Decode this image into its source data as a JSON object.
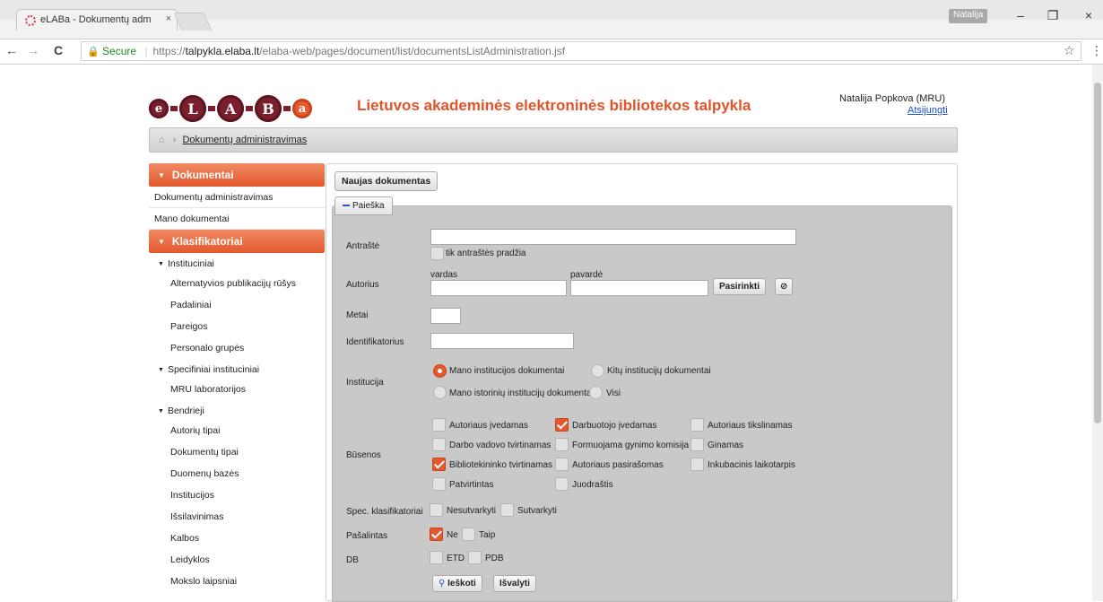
{
  "browser": {
    "tab_title": "eLABa - Dokumentų adm",
    "tab_close": "×",
    "profile": "Natalija",
    "win_min": "–",
    "win_restore": "❐",
    "win_close": "×",
    "nav_back": "←",
    "nav_forward": "→",
    "nav_reload": "C",
    "secure_label": "Secure",
    "url_scheme": "https://",
    "url_host": "talpykla.elaba.lt",
    "url_path": "/elaba-web/pages/document/list/documentsListAdministration.jsf",
    "star": "☆",
    "menu": "⋮"
  },
  "header": {
    "logo_letters": [
      "e",
      "L",
      "A",
      "B",
      "a"
    ],
    "site_title": "Lietuvos akademinės elektroninės bibliotekos talpykla",
    "user_name": "Natalija Popkova (MRU)",
    "logout": "Atsijungti"
  },
  "breadcrumb": {
    "home_icon": "⌂",
    "separator": "›",
    "current": "Dokumentų administravimas"
  },
  "sidebar": {
    "documents_header": "Dokumentai",
    "documents_items": [
      "Dokumentų administravimas",
      "Mano dokumentai"
    ],
    "classifiers_header": "Klasifikatoriai",
    "group_institutional": "Instituciniai",
    "institutional_items": [
      "Alternatyvios publikacijų rūšys",
      "Padaliniai",
      "Pareigos",
      "Personalo grupės"
    ],
    "group_specific": "Specifiniai instituciniai",
    "specific_items": [
      "MRU laboratorijos"
    ],
    "group_common": "Bendrieji",
    "common_items": [
      "Autorių tipai",
      "Dokumentų tipai",
      "Duomenų bazės",
      "Institucijos",
      "Išsilavinimas",
      "Kalbos",
      "Leidyklos",
      "Mokslo laipsniai"
    ]
  },
  "main": {
    "new_document_button": "Naujas dokumentas",
    "search_toggle": "Paieška",
    "title_label": "Antraštė",
    "title_value": "",
    "title_start_only": "tik antraštės pradžia",
    "author_label": "Autorius",
    "first_name_label": "vardas",
    "last_name_label": "pavardė",
    "choose_button": "Pasirinkti",
    "clear_author_icon": "⊘",
    "year_label": "Metai",
    "identifier_label": "Identifikatorius",
    "institution_label": "Institucija",
    "institution_options": [
      "Mano institucijos dokumentai",
      "Kitų institucijų dokumentai",
      "Mano istorinių institucijų dokumentai",
      "Visi"
    ],
    "institution_selected": "Mano institucijos dokumentai",
    "states_label": "Būsenos",
    "states": [
      {
        "label": "Autoriaus įvedamas",
        "checked": false
      },
      {
        "label": "Darbuotojo įvedamas",
        "checked": true
      },
      {
        "label": "Autoriaus tikslinamas",
        "checked": false
      },
      {
        "label": "Darbo vadovo tvirtinamas",
        "checked": false
      },
      {
        "label": "Formuojama gynimo komisija",
        "checked": false
      },
      {
        "label": "Ginamas",
        "checked": false
      },
      {
        "label": "Bibliotekininko tvirtinamas",
        "checked": true
      },
      {
        "label": "Autoriaus pasirašomas",
        "checked": false
      },
      {
        "label": "Inkubacinis laikotarpis",
        "checked": false
      },
      {
        "label": "Patvirtintas",
        "checked": false
      },
      {
        "label": "Juodraštis",
        "checked": false
      }
    ],
    "spec_label": "Spec. klasifikatoriai",
    "spec_options": [
      {
        "label": "Nesutvarkyti",
        "checked": false
      },
      {
        "label": "Sutvarkyti",
        "checked": false
      }
    ],
    "removed_label": "Pašalintas",
    "removed_options": [
      {
        "label": "Ne",
        "checked": true
      },
      {
        "label": "Taip",
        "checked": false
      }
    ],
    "db_label": "DB",
    "db_options": [
      {
        "label": "ETD",
        "checked": false
      },
      {
        "label": "PDB",
        "checked": false
      }
    ],
    "search_button": "Ieškoti",
    "search_icon": "⚲",
    "clear_button": "Išvalyti"
  },
  "colors": {
    "accent": "#e4582d",
    "logo": "#7a1f2e",
    "title": "#e2532a"
  }
}
